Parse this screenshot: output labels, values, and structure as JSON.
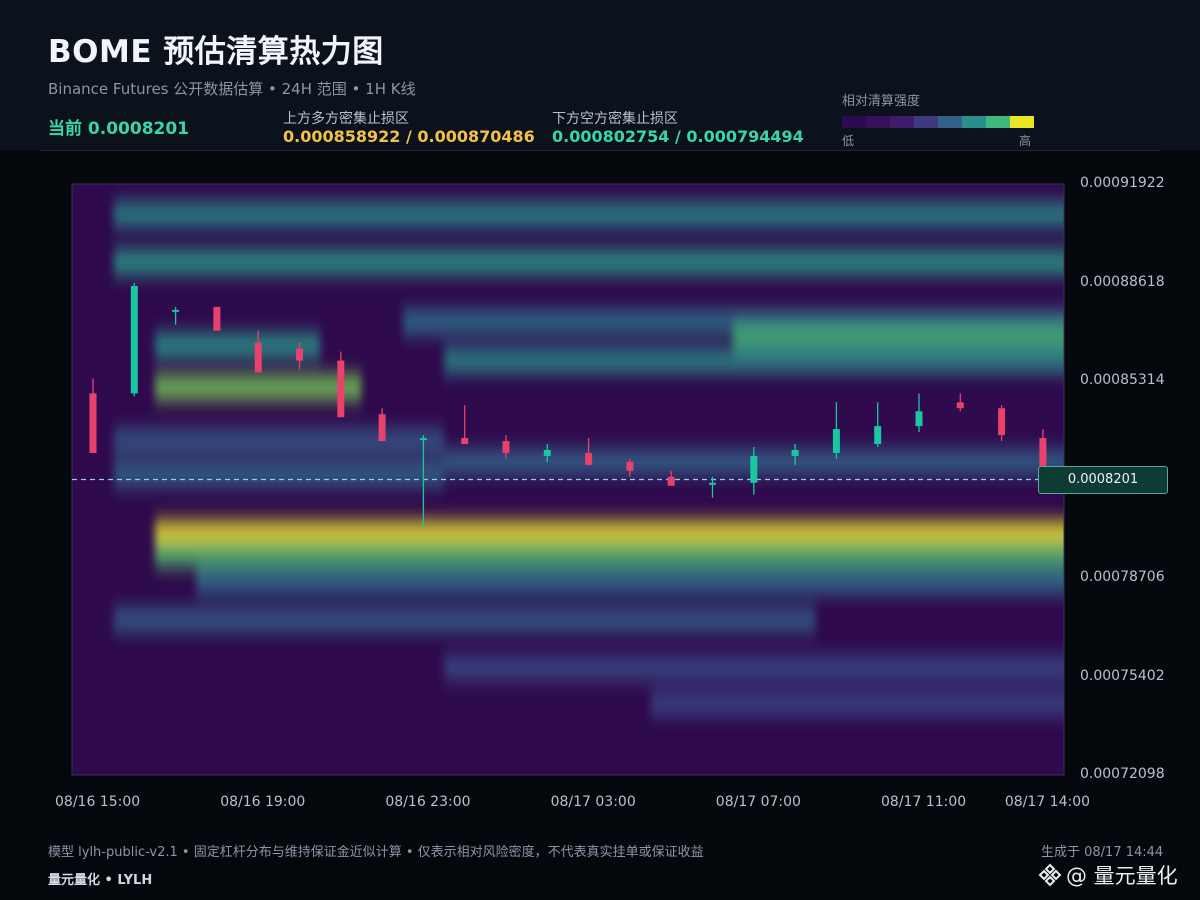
{
  "header": {
    "title": "BOME 预估清算热力图",
    "subtitle": "Binance Futures 公开数据估算 • 24H 范围 • 1H K线",
    "current_label": "当前 0.0008201",
    "upper_zone_label": "上方多方密集止损区",
    "upper_zone_value": "0.000858922 / 0.000870486",
    "lower_zone_label": "下方空方密集止损区",
    "lower_zone_value": "0.000802754 / 0.000794494"
  },
  "colorbar": {
    "title": "相对清算强度",
    "low": "低",
    "high": "高",
    "colors": [
      "#2b0a4f",
      "#37105a",
      "#3f1d6a",
      "#3d3a7e",
      "#345f8a",
      "#2a8f8a",
      "#3fb87b",
      "#e8e426"
    ]
  },
  "price_tag": "0.0008201",
  "footer": {
    "note": "模型 lylh-public-v2.1 • 固定杠杆分布与维持保证金近似计算 • 仅表示相对风险密度，不代表真实挂单或保证收益",
    "generated": "生成于 08/17 14:44",
    "brand": "量元量化 • LYLH",
    "watermark": "@ 量元量化"
  },
  "colors": {
    "up": "#19c8a0",
    "down": "#e8416b",
    "current_line": "#8fd3e0",
    "plot_bg": "#2f0a4d"
  },
  "chart_data": {
    "type": "heatmap",
    "title": "BOME 预估清算热力图",
    "y_ticks": [
      "0.00091922",
      "0.00088618",
      "0.00085314",
      "0.00082010",
      "0.00078706",
      "0.00075402",
      "0.00072098"
    ],
    "y_tick_labels": [
      "0.00091922",
      "0.00088618",
      "0.00085314",
      "0.00078706",
      "0.00075402",
      "0.00072098"
    ],
    "ylim": [
      0.00072098,
      0.00091922
    ],
    "x_tick_labels": [
      "08/16 15:00",
      "08/16 19:00",
      "08/16 23:00",
      "08/17 03:00",
      "08/17 07:00",
      "08/17 11:00",
      "08/17 14:00"
    ],
    "current_price": 0.0008201,
    "candles": {
      "time": [
        "08/16 15:00",
        "08/16 16:00",
        "08/16 17:00",
        "08/16 18:00",
        "08/16 19:00",
        "08/16 20:00",
        "08/16 21:00",
        "08/16 22:00",
        "08/16 23:00",
        "08/17 00:00",
        "08/17 01:00",
        "08/17 02:00",
        "08/17 03:00",
        "08/17 04:00",
        "08/17 05:00",
        "08/17 06:00",
        "08/17 07:00",
        "08/17 08:00",
        "08/17 09:00",
        "08/17 10:00",
        "08/17 11:00",
        "08/17 12:00",
        "08/17 13:00",
        "08/17 14:00"
      ],
      "open": [
        0.000849,
        0.000849,
        0.000877,
        0.000878,
        0.000866,
        0.000864,
        0.00086,
        0.000842,
        0.000834,
        0.000834,
        0.000833,
        0.000828,
        0.000829,
        0.000826,
        0.000821,
        0.000819,
        0.000819,
        0.000828,
        0.000829,
        0.000832,
        0.000838,
        0.000846,
        0.000844,
        0.000834
      ],
      "high": [
        0.000854,
        0.000886,
        0.000878,
        0.000878,
        0.00087,
        0.000866,
        0.000863,
        0.000844,
        0.000835,
        0.000845,
        0.000835,
        0.000832,
        0.000834,
        0.000827,
        0.000823,
        0.000821,
        0.000831,
        0.000832,
        0.000846,
        0.000846,
        0.000849,
        0.000849,
        0.000845,
        0.000837
      ],
      "low": [
        0.000848,
        0.000848,
        0.000872,
        0.000872,
        0.000862,
        0.000857,
        0.000846,
        0.000834,
        0.000804,
        0.000832,
        0.000827,
        0.000826,
        0.000827,
        0.000821,
        0.000818,
        0.000814,
        0.000815,
        0.000825,
        0.000827,
        0.000831,
        0.000836,
        0.000843,
        0.000833,
        0.000824
      ],
      "close": [
        0.000829,
        0.000885,
        0.000877,
        0.00087,
        0.000856,
        0.00086,
        0.000841,
        0.000833,
        0.000834,
        0.000832,
        0.000829,
        0.00083,
        0.000825,
        0.000823,
        0.000818,
        0.000819,
        0.000828,
        0.00083,
        0.000837,
        0.000838,
        0.000843,
        0.000844,
        0.000835,
        0.000824
      ]
    },
    "bands": [
      {
        "price": 0.000909,
        "intensity": 0.55,
        "start": "08/16 16:00"
      },
      {
        "price": 0.000893,
        "intensity": 0.62,
        "start": "08/16 16:00"
      },
      {
        "price": 0.000873,
        "intensity": 0.45,
        "start": "08/16 23:00"
      },
      {
        "price": 0.000868,
        "intensity": 0.72,
        "start": "08/17 07:00"
      },
      {
        "price": 0.00086,
        "intensity": 0.55,
        "start": "08/17 00:00"
      },
      {
        "price": 0.000865,
        "intensity": 0.6,
        "start": "08/16 17:00",
        "end": "08/16 20:00"
      },
      {
        "price": 0.000851,
        "intensity": 0.82,
        "start": "08/16 17:00",
        "end": "08/16 21:00"
      },
      {
        "price": 0.000833,
        "intensity": 0.35,
        "start": "08/16 16:00",
        "end": "08/16 23:00"
      },
      {
        "price": 0.000822,
        "intensity": 0.42,
        "start": "08/16 16:00",
        "end": "08/16 23:00"
      },
      {
        "price": 0.000826,
        "intensity": 0.4,
        "start": "08/17 00:00"
      },
      {
        "price": 0.000802,
        "intensity": 1.0,
        "start": "08/16 17:00"
      },
      {
        "price": 0.000795,
        "intensity": 0.75,
        "start": "08/16 17:00"
      },
      {
        "price": 0.000786,
        "intensity": 0.45,
        "start": "08/16 18:00"
      },
      {
        "price": 0.000773,
        "intensity": 0.38,
        "start": "08/16 16:00",
        "end": "08/17 08:00"
      },
      {
        "price": 0.000757,
        "intensity": 0.3,
        "start": "08/17 00:00"
      },
      {
        "price": 0.000745,
        "intensity": 0.28,
        "start": "08/17 05:00"
      }
    ]
  }
}
